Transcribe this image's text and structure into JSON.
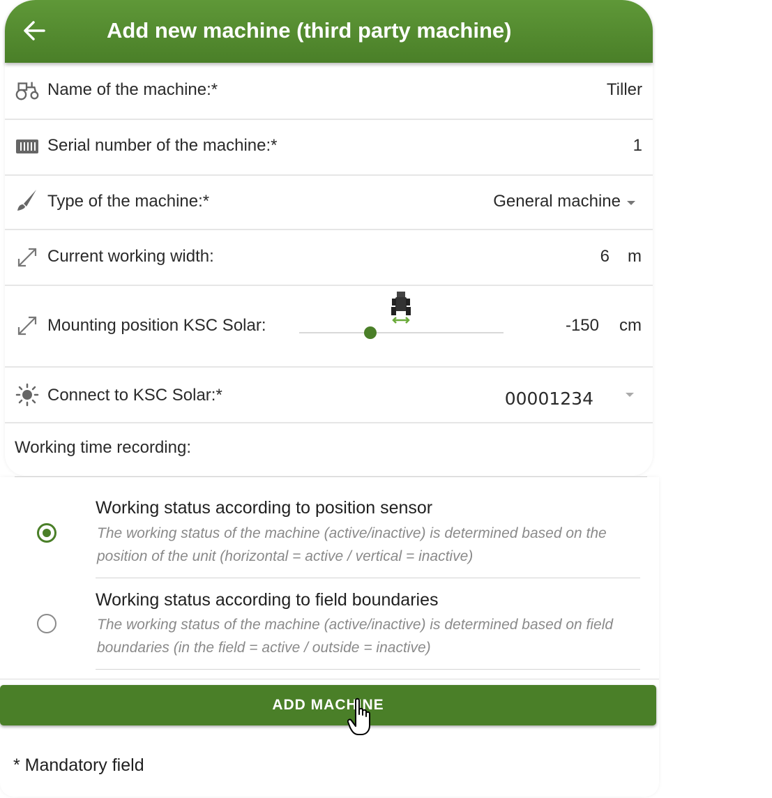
{
  "header": {
    "title": "Add new machine (third party machine)",
    "back_icon": "arrow-left-icon"
  },
  "fields": {
    "name": {
      "label": "Name of the machine:*",
      "value": "Tiller",
      "icon": "tractor-icon"
    },
    "serial": {
      "label": "Serial number of the machine:*",
      "value": "1",
      "icon": "barcode-icon"
    },
    "type": {
      "label": "Type of the machine:*",
      "value": "General machine",
      "icon": "brush-icon"
    },
    "width": {
      "label": "Current working width:",
      "value": "6",
      "unit": "m",
      "icon": "resize-arrow-icon"
    },
    "mounting": {
      "label": "Mounting position KSC Solar:",
      "value": "-150",
      "unit": "cm",
      "slider_fraction": 0.35,
      "icon": "resize-arrow-icon"
    },
    "connect": {
      "label": "Connect to KSC Solar:*",
      "value": "00001234",
      "icon": "sun-icon"
    }
  },
  "working_time": {
    "label": "Working time recording:",
    "options": [
      {
        "title": "Working status according to position sensor",
        "description": "The working status of the machine (active/inactive) is determined based on the position of the unit (horizontal = active / vertical = inactive)",
        "selected": true
      },
      {
        "title": "Working status according to field boundaries",
        "description": "The working status of the machine (active/inactive) is determined based on field boundaries (in the field = active / outside = inactive)",
        "selected": false
      }
    ]
  },
  "actions": {
    "add_label": "ADD MACHINE"
  },
  "footer": {
    "mandatory_note": "* Mandatory field"
  },
  "colors": {
    "brand_green": "#4a7f28",
    "header_green_top": "#5f9838"
  }
}
